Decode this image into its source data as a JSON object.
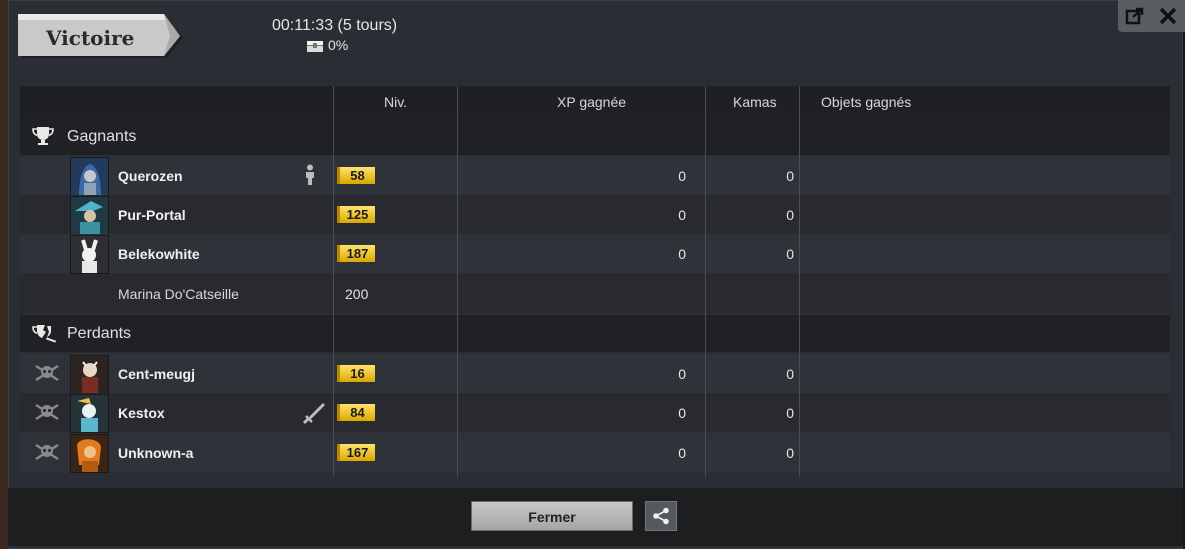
{
  "header": {
    "result_label": "Victoire",
    "duration": "00:11:33 (5 tours)",
    "chest_percent": "0%"
  },
  "table": {
    "columns": [
      "Niv.",
      "XP gagnée",
      "Kamas",
      "Objets gagnés"
    ],
    "winners_label": "Gagnants",
    "losers_label": "Perdants",
    "winners": [
      {
        "name": "Querozen",
        "level": "58",
        "xp": "0",
        "kamas": "0",
        "avatar_icon": "blue-hooded-character-icon",
        "status_icon": "standing-person-icon"
      },
      {
        "name": "Pur-Portal",
        "level": "125",
        "xp": "0",
        "kamas": "0",
        "avatar_icon": "teal-armored-character-icon"
      },
      {
        "name": "Belekowhite",
        "level": "187",
        "xp": "0",
        "kamas": "0",
        "avatar_icon": "white-rabbit-character-icon"
      },
      {
        "name": "Marina Do'Catseille",
        "level": "200"
      }
    ],
    "losers": [
      {
        "name": "Cent-meugj",
        "level": "16",
        "xp": "0",
        "kamas": "0",
        "avatar_icon": "brown-cow-character-icon"
      },
      {
        "name": "Kestox",
        "level": "84",
        "xp": "0",
        "kamas": "0",
        "avatar_icon": "white-cat-character-icon",
        "status_icon": "sword-icon"
      },
      {
        "name": "Unknown-a",
        "level": "167",
        "xp": "0",
        "kamas": "0",
        "avatar_icon": "orange-fox-character-icon"
      }
    ]
  },
  "footer": {
    "close_label": "Fermer"
  },
  "colors": {
    "level_badge": "#f2c200",
    "window_bg": "#2a2d33"
  }
}
